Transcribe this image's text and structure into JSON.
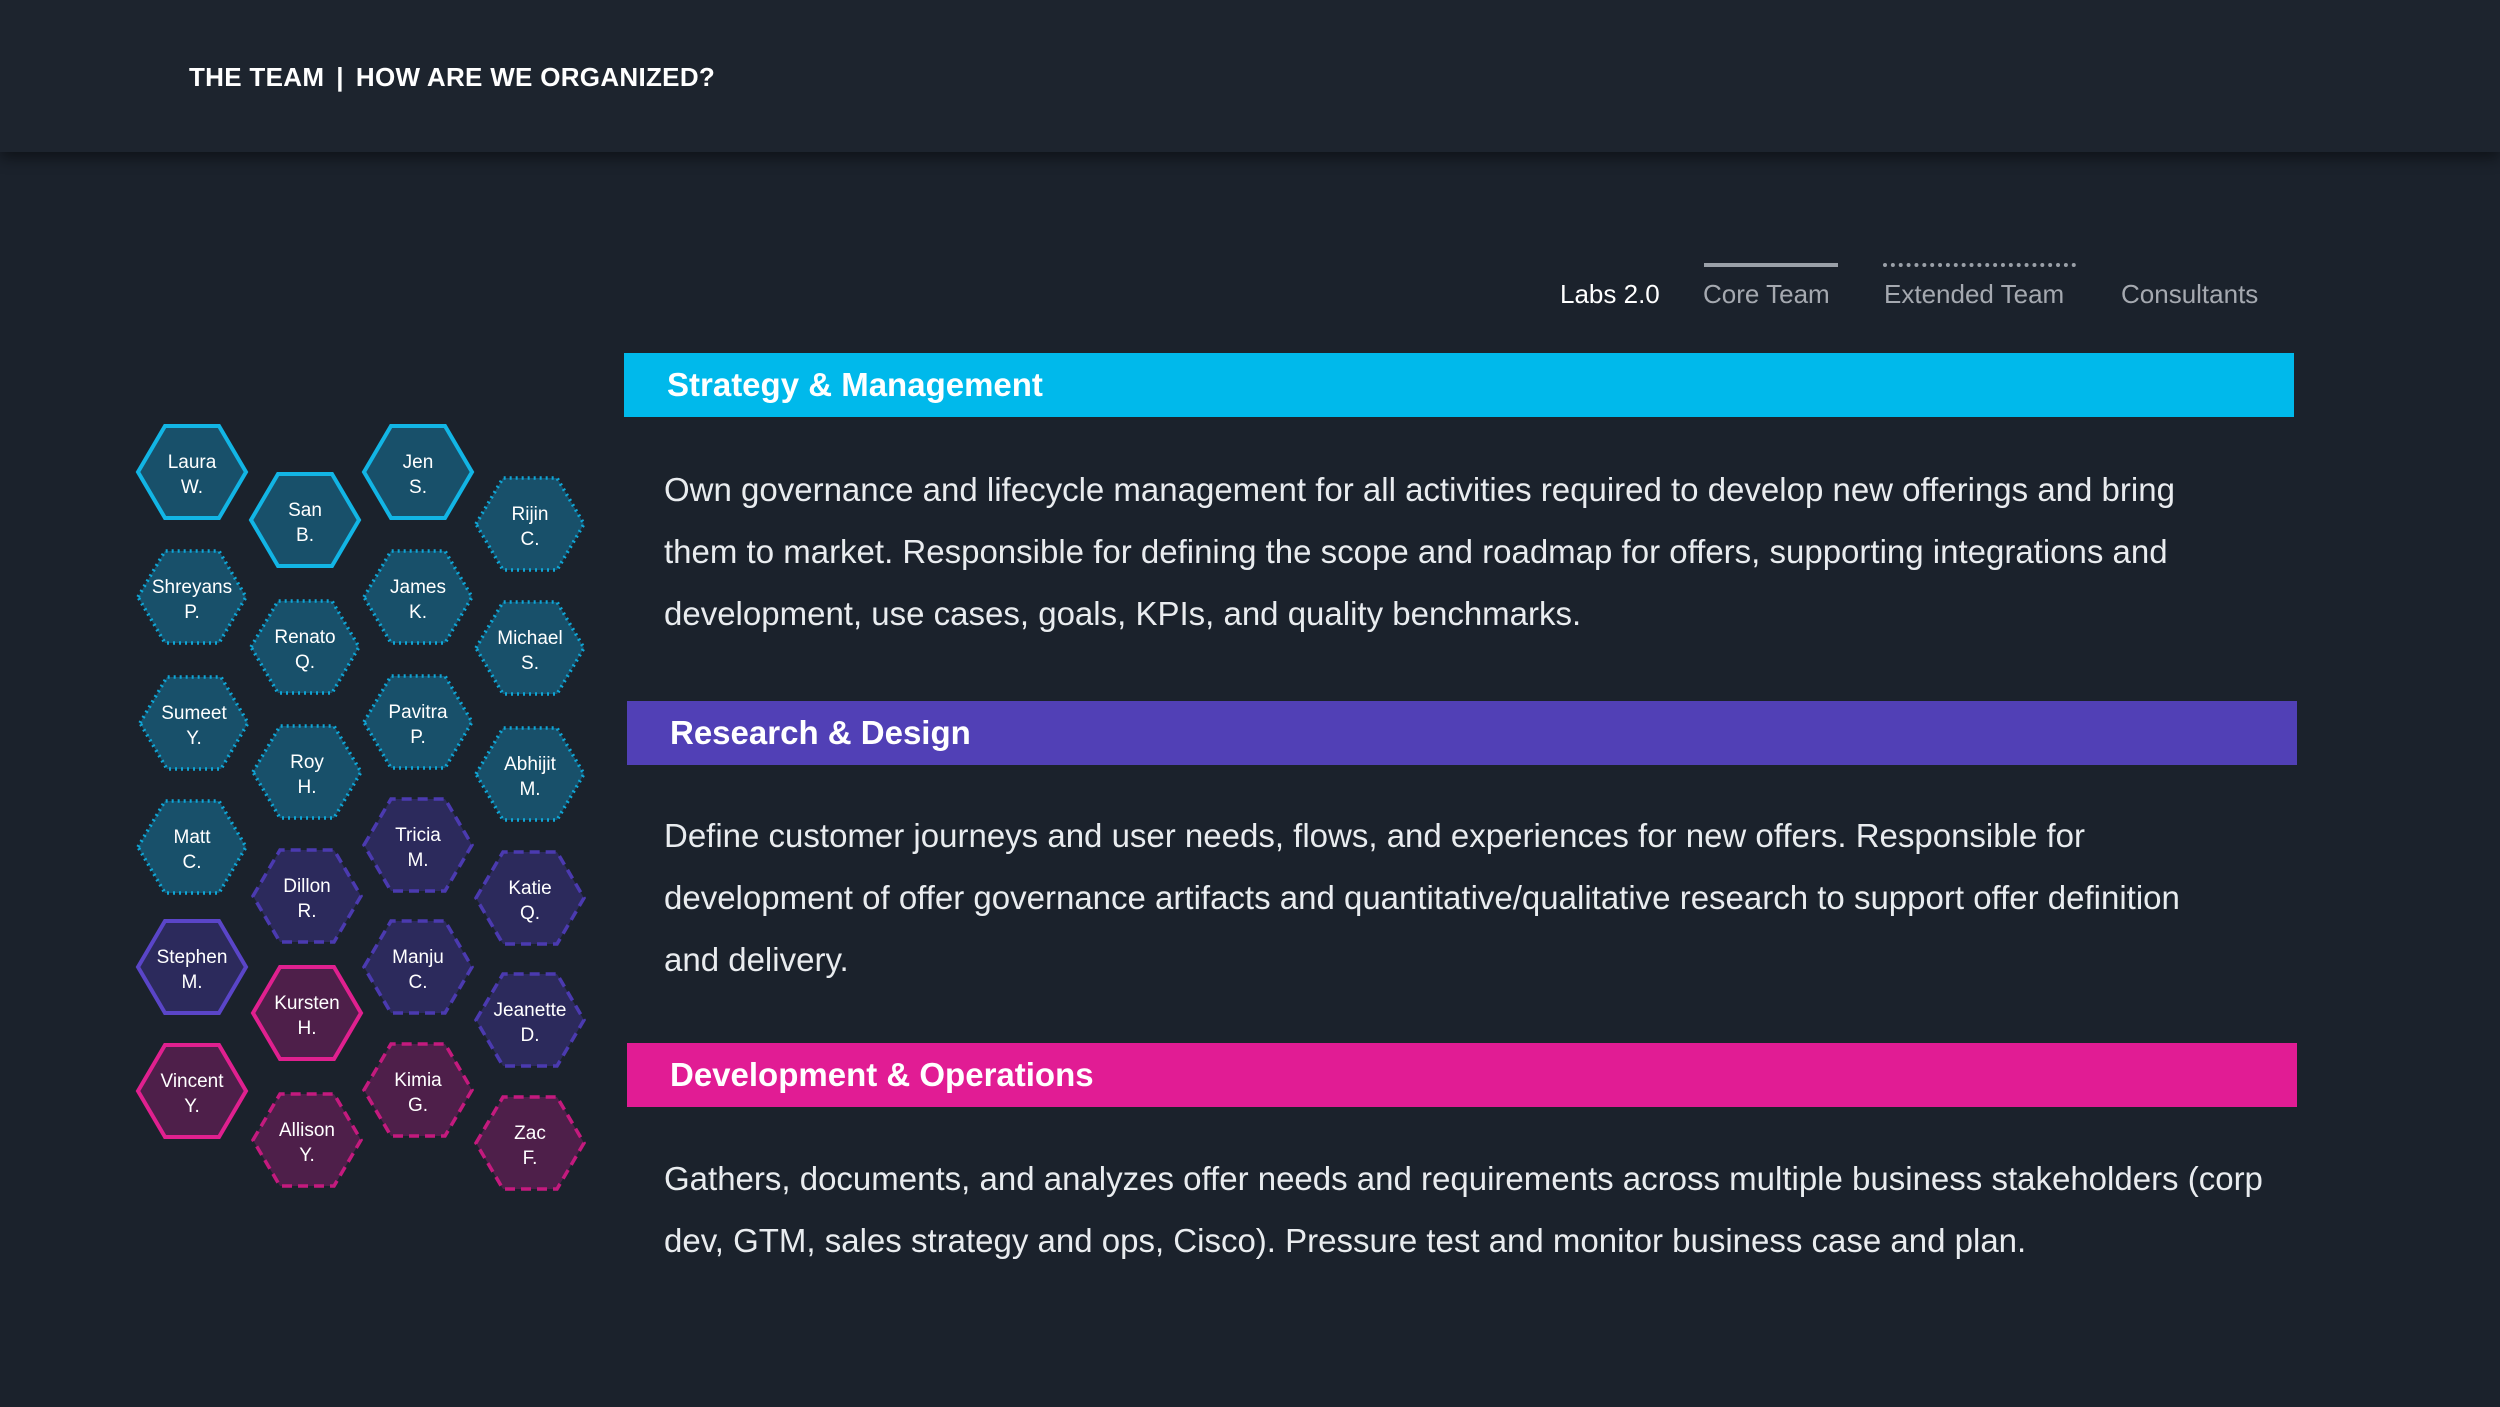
{
  "header": {
    "part1": "THE TEAM",
    "separator": "|",
    "part2": "HOW ARE WE ORGANIZED?"
  },
  "legend": {
    "title": "Labs 2.0",
    "items": [
      {
        "label": "Core Team",
        "line_style": "solid"
      },
      {
        "label": "Extended Team",
        "line_style": "dotted"
      },
      {
        "label": "Consultants",
        "line_style": "dash-dot"
      }
    ]
  },
  "colors": {
    "strategy": "#00b9eb",
    "research": "#5140b6",
    "development": "#e11c94",
    "background": "#1b222c"
  },
  "sections": [
    {
      "id": "strategy",
      "title": "Strategy & Management",
      "lines": [
        "Own governance and lifecycle management for all activities required to develop new offerings and bring",
        "them to market.  Responsible for defining the scope and roadmap for offers, supporting integrations and",
        "development, use cases, goals, KPIs, and quality benchmarks."
      ]
    },
    {
      "id": "research",
      "title": "Research & Design",
      "lines": [
        "Define customer journeys and user needs, flows, and experiences for new offers.  Responsible for",
        "development of offer governance artifacts and quantitative/qualitative research to support offer definition",
        "and delivery."
      ]
    },
    {
      "id": "development",
      "title": "Development & Operations",
      "lines": [
        "Gathers, documents, and analyzes offer needs and requirements across multiple business stakeholders (corp",
        "dev, GTM, sales strategy and ops, Cisco).  Pressure test and monitor business case and plan."
      ]
    }
  ],
  "team": [
    {
      "first": "Laura",
      "last": "W.",
      "group": "strategy",
      "type": "solid"
    },
    {
      "first": "San",
      "last": "B.",
      "group": "strategy",
      "type": "solid"
    },
    {
      "first": "Jen",
      "last": "S.",
      "group": "strategy",
      "type": "solid"
    },
    {
      "first": "Rijin",
      "last": "C.",
      "group": "strategy",
      "type": "dotted"
    },
    {
      "first": "Shreyans",
      "last": "P.",
      "group": "strategy",
      "type": "dotted"
    },
    {
      "first": "Renato",
      "last": "Q.",
      "group": "strategy",
      "type": "dotted"
    },
    {
      "first": "James",
      "last": "K.",
      "group": "strategy",
      "type": "dotted"
    },
    {
      "first": "Michael",
      "last": "S.",
      "group": "strategy",
      "type": "dotted"
    },
    {
      "first": "Sumeet",
      "last": "Y.",
      "group": "strategy",
      "type": "dotted"
    },
    {
      "first": "Roy",
      "last": "H.",
      "group": "strategy",
      "type": "dotted"
    },
    {
      "first": "Pavitra",
      "last": "P.",
      "group": "strategy",
      "type": "dotted"
    },
    {
      "first": "Abhijit",
      "last": "M.",
      "group": "strategy",
      "type": "dotted"
    },
    {
      "first": "Matt",
      "last": "C.",
      "group": "strategy",
      "type": "dotted"
    },
    {
      "first": "Dillon",
      "last": "R.",
      "group": "research",
      "type": "dashed"
    },
    {
      "first": "Tricia",
      "last": "M.",
      "group": "research",
      "type": "dashed"
    },
    {
      "first": "Katie",
      "last": "Q.",
      "group": "research",
      "type": "dashed"
    },
    {
      "first": "Stephen",
      "last": "M.",
      "group": "research",
      "type": "solid"
    },
    {
      "first": "Manju",
      "last": "C.",
      "group": "research",
      "type": "dashed"
    },
    {
      "first": "Kursten",
      "last": "H.",
      "group": "development",
      "type": "solid"
    },
    {
      "first": "Jeanette",
      "last": "D.",
      "group": "research",
      "type": "dashed"
    },
    {
      "first": "Vincent",
      "last": "Y.",
      "group": "development",
      "type": "solid"
    },
    {
      "first": "Kimia",
      "last": "G.",
      "group": "development",
      "type": "dashed"
    },
    {
      "first": "Allison",
      "last": "Y.",
      "group": "development",
      "type": "dashed"
    },
    {
      "first": "Zac",
      "last": "F.",
      "group": "development",
      "type": "dashed"
    }
  ]
}
